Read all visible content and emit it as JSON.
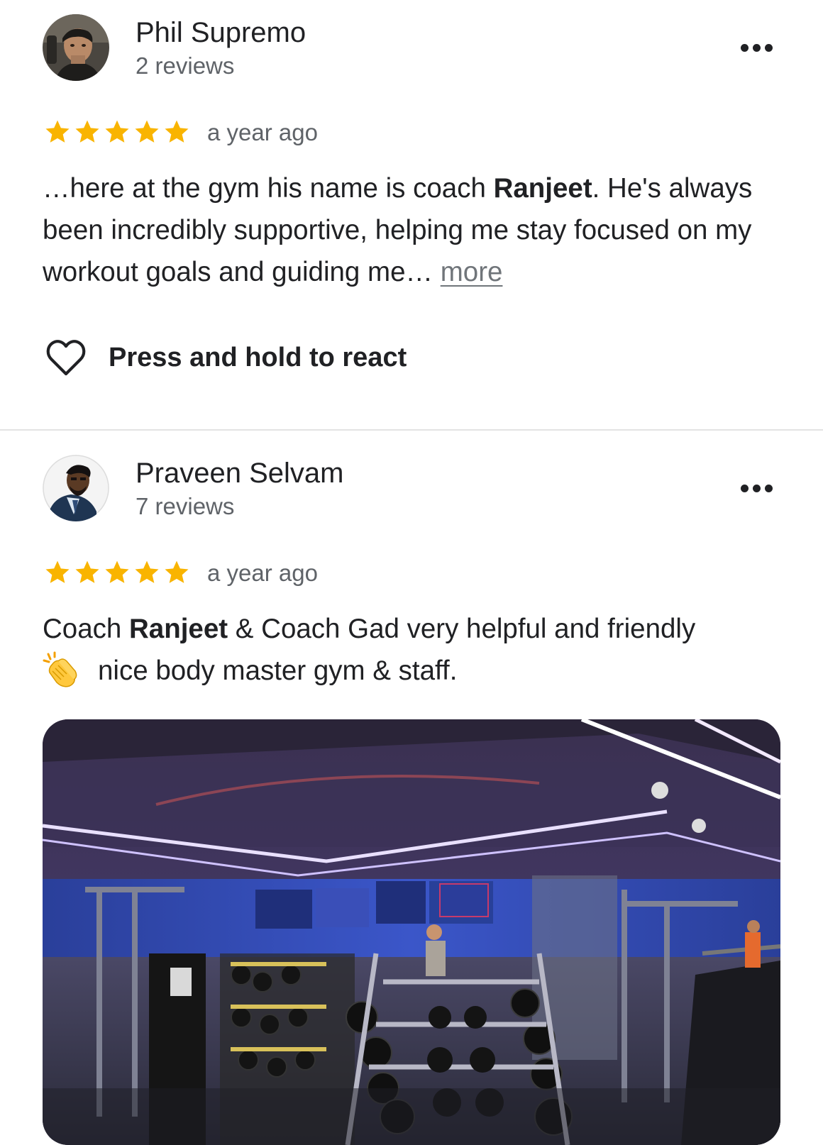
{
  "reviews": [
    {
      "reviewer_name": "Phil Supremo",
      "review_count": "2 reviews",
      "rating": 5,
      "time": "a year ago",
      "text": {
        "part1": "…here at the gym his name is coach ",
        "bold1": "Ranjeet",
        "part2": ". He's always been incredibly supportive, helping me stay focused on my workout goals and guiding me… ",
        "more_link": "more"
      },
      "react_label": "Press and hold to react"
    },
    {
      "reviewer_name": "Praveen Selvam",
      "review_count": "7 reviews",
      "rating": 5,
      "time": "a year ago",
      "text": {
        "part1": "Coach ",
        "bold1": "Ranjeet",
        "part2": " & Coach Gad very helpful and friendly",
        "emoji": "👏",
        "part3": "nice body master gym & staff."
      }
    }
  ],
  "colors": {
    "star": "#f9b400",
    "text": "#202124",
    "secondary": "#5f6368",
    "divider": "#e3e3e3"
  },
  "icons": {
    "more_menu": "more-horizontal-icon",
    "react": "heart-outline-icon",
    "star": "star-filled-icon",
    "emoji": "clapping-hands-icon"
  }
}
